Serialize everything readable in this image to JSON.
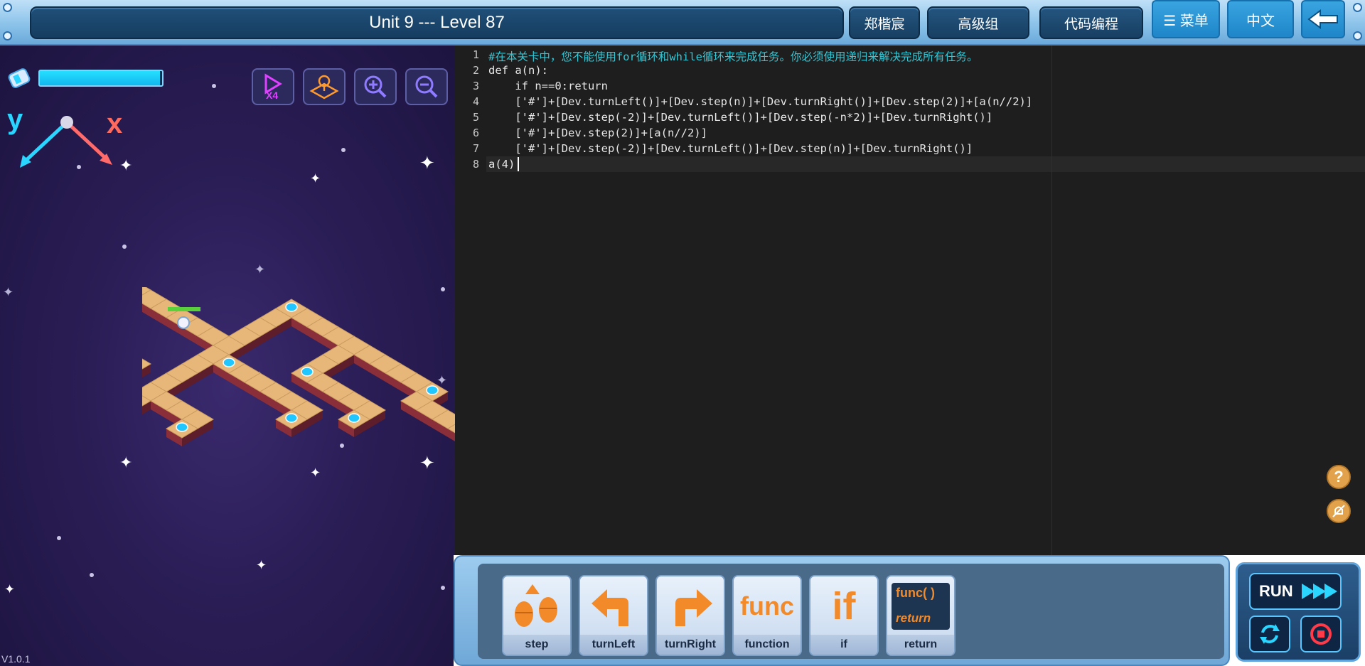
{
  "topbar": {
    "title": "Unit 9 --- Level 87",
    "user_name": "郑楷宸",
    "group_label": "高级组",
    "mode_label": "代码编程",
    "menu_label": "☰ 菜单",
    "lang_label": "中文",
    "back_icon": "back-arrow-icon"
  },
  "game": {
    "energy_level": 0.98,
    "axis_y": "y",
    "axis_x": "x",
    "speed_label": "X4",
    "version": "V1.0.1",
    "accent": "#2ad5ff"
  },
  "editor": {
    "line_numbers": [
      "1",
      "2",
      "3",
      "4",
      "5",
      "6",
      "7",
      "8"
    ],
    "lines": [
      "#在本关卡中，您不能使用for循环和while循环来完成任务。你必须使用递归来解决完成所有任务。",
      "def a(n):",
      "    if n==0:return",
      "    ['#']+[Dev.turnLeft()]+[Dev.step(n)]+[Dev.turnRight()]+[Dev.step(2)]+[a(n//2)]",
      "    ['#']+[Dev.step(-2)]+[Dev.turnLeft()]+[Dev.step(-n*2)]+[Dev.turnRight()]",
      "    ['#']+[Dev.step(2)]+[a(n//2)]",
      "    ['#']+[Dev.step(-2)]+[Dev.turnLeft()]+[Dev.step(n)]+[Dev.turnRight()]",
      "a(4)"
    ]
  },
  "blocks": {
    "items": [
      {
        "label": "step",
        "icon": "footsteps-icon"
      },
      {
        "label": "turnLeft",
        "icon": "turn-left-arrow-icon"
      },
      {
        "label": "turnRight",
        "icon": "turn-right-arrow-icon"
      },
      {
        "label": "function",
        "icon": "func-icon",
        "icon_text": "func"
      },
      {
        "label": "if",
        "icon": "if-icon",
        "icon_text": "if"
      },
      {
        "label": "return",
        "icon": "func-return-icon",
        "icon_text_top": "func( )",
        "icon_text_bottom": "return"
      }
    ]
  },
  "controls": {
    "run_label": "RUN",
    "help": "?",
    "colors": {
      "code_comment": "#33c7d6",
      "code_keyword": "#e6a04a",
      "code_method": "#a7c93a",
      "code_number": "#f08c5a"
    }
  }
}
